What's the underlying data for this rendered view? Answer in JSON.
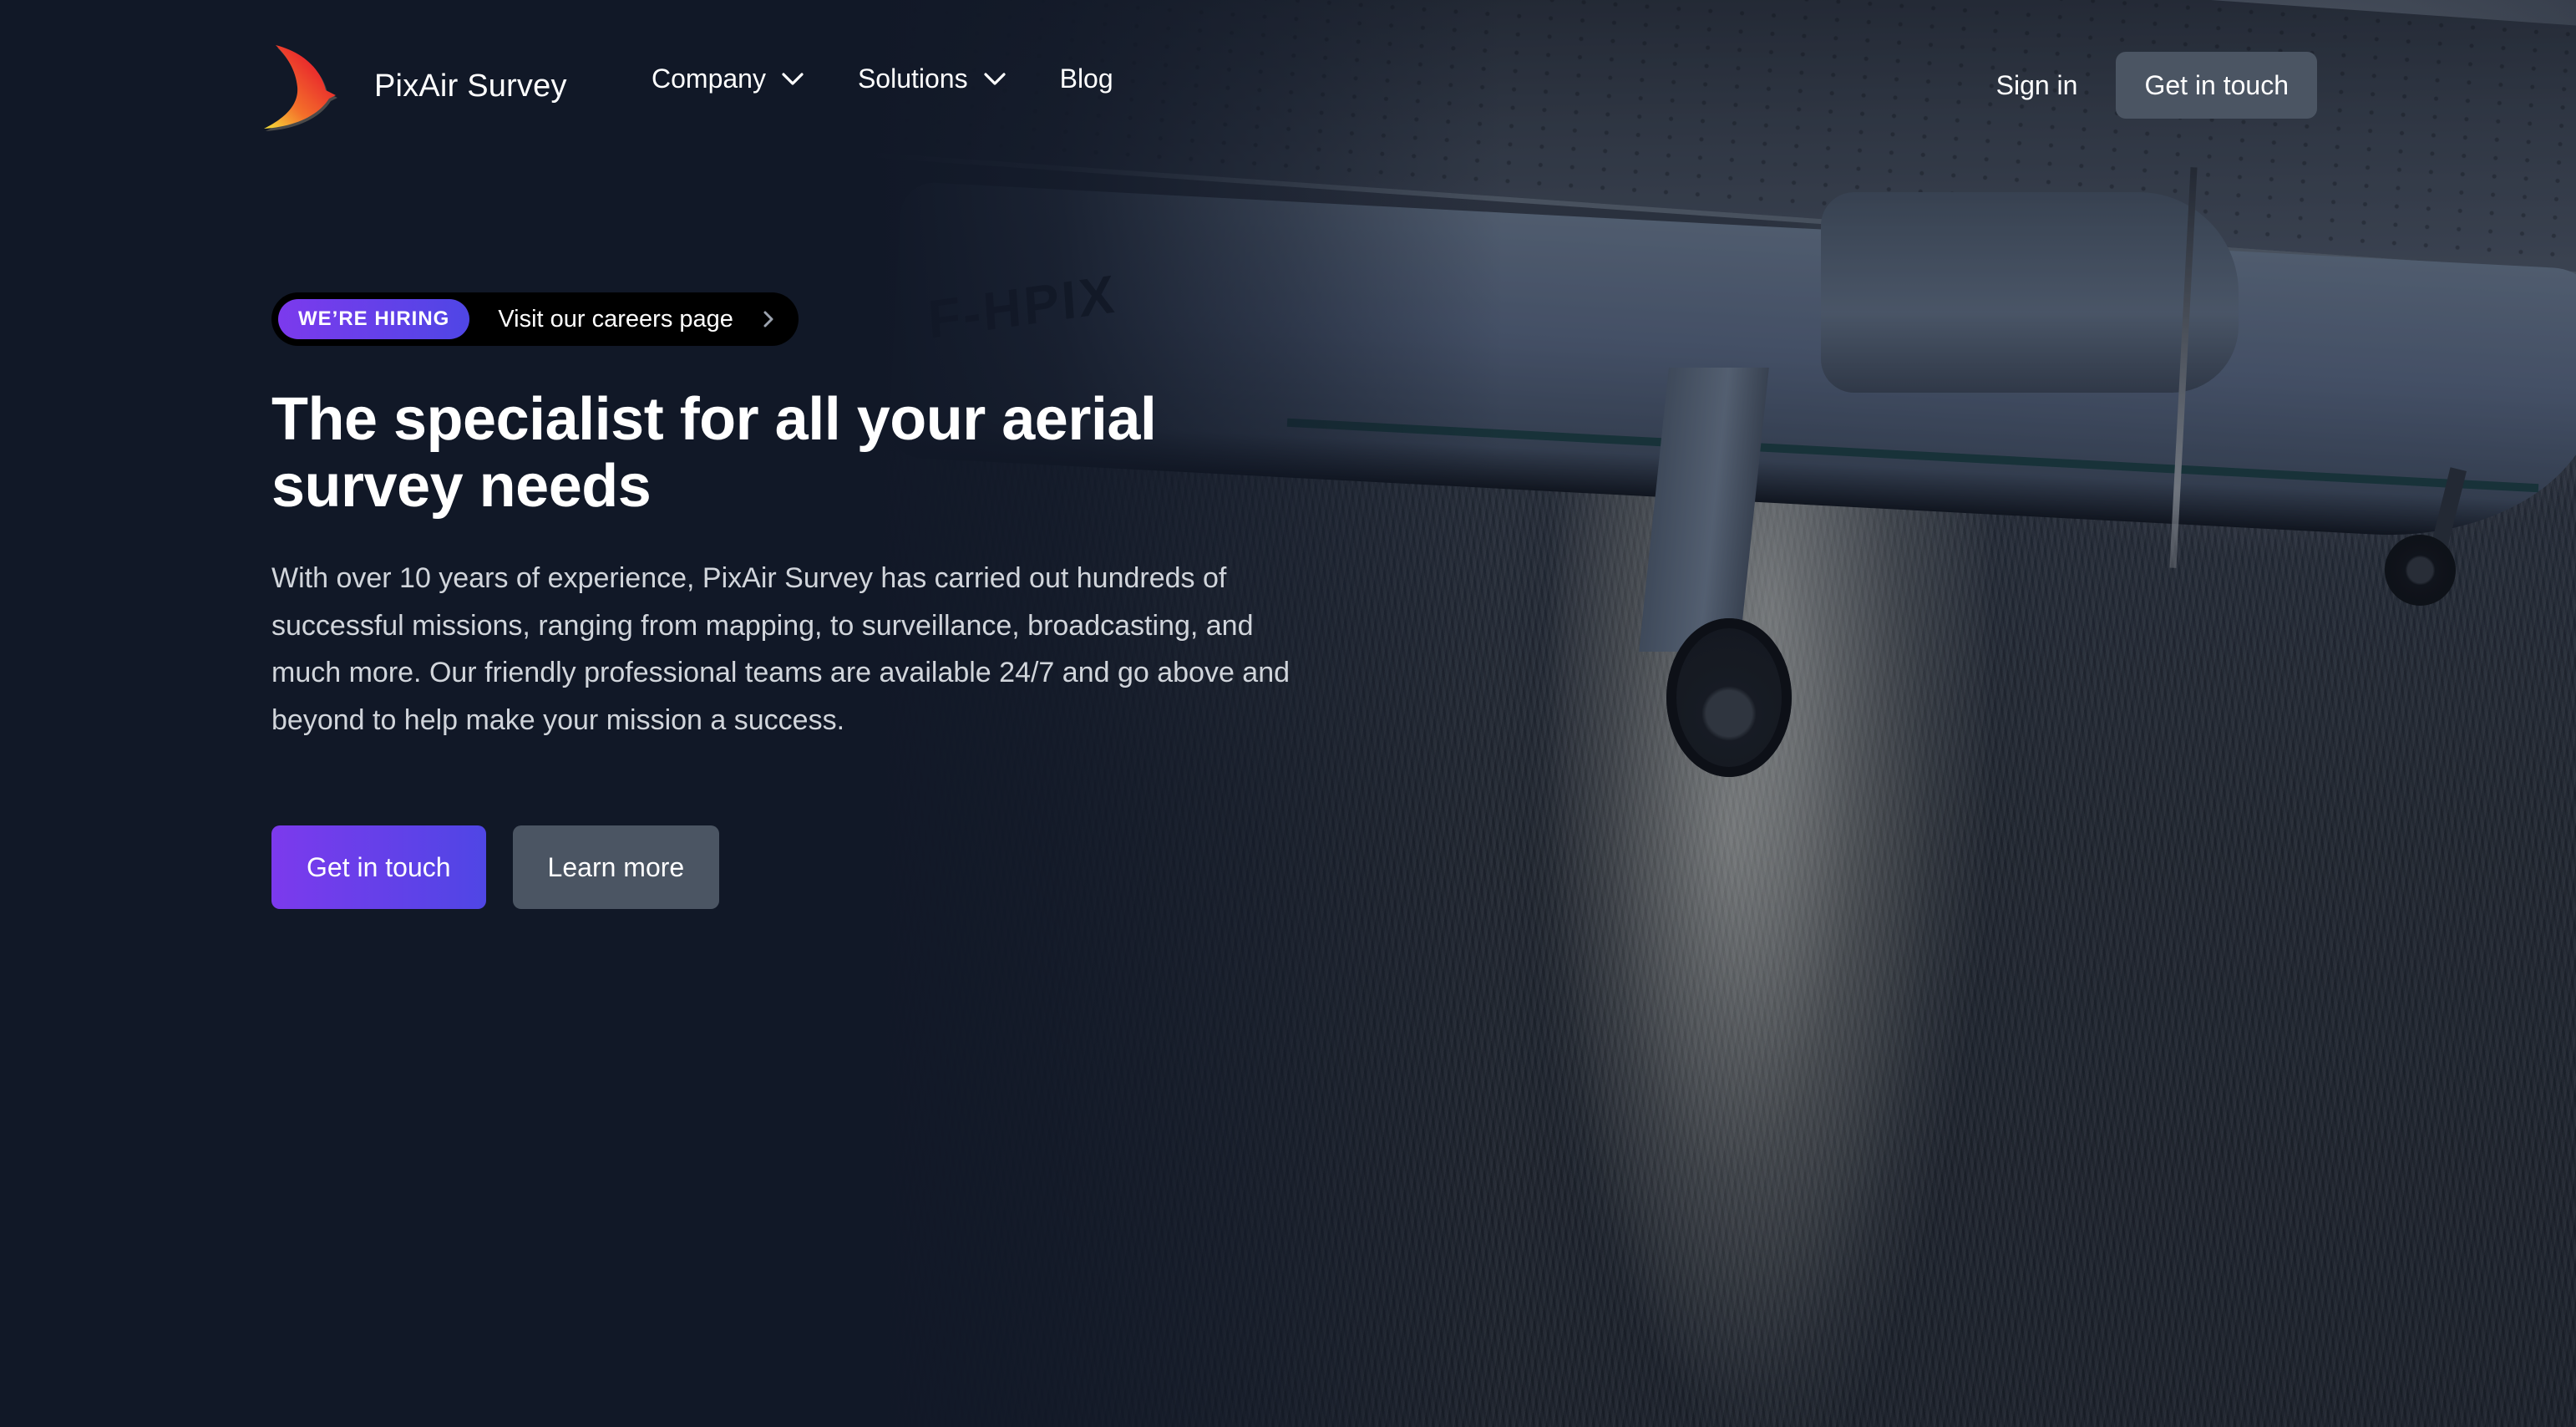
{
  "brand": {
    "name": "PixAir Survey",
    "logo_icon": "bird-swoosh-logo",
    "logo_colors": [
      "#e8262d",
      "#f4562a",
      "#f7d23a"
    ]
  },
  "nav": {
    "items": [
      {
        "label": "Company",
        "has_dropdown": true,
        "icon": "chevron-down-icon"
      },
      {
        "label": "Solutions",
        "has_dropdown": true,
        "icon": "chevron-down-icon"
      },
      {
        "label": "Blog",
        "has_dropdown": false
      }
    ],
    "sign_in": "Sign in",
    "cta": "Get in touch"
  },
  "hero": {
    "announcement": {
      "badge": "WE’RE HIRING",
      "text": "Visit our careers page",
      "icon": "chevron-right-icon"
    },
    "title": "The specialist for all your aerial survey needs",
    "description": "With over 10 years of experience, PixAir Survey has carried out hundreds of successful missions, ranging from mapping, to surveillance, broadcasting, and much more. Our friendly professional teams are available 24/7 and go above and beyond to help make your mission a success.",
    "primary_button": "Get in touch",
    "secondary_button": "Learn more",
    "image": {
      "subject": "aircraft-flying-over-sea",
      "registration": "F-HPIX"
    }
  },
  "colors": {
    "background": "#111827",
    "accent_gradient_start": "#7c3aed",
    "accent_gradient_end": "#4f46e5",
    "secondary_button": "#4b5563",
    "body_text": "#d1d5db"
  }
}
